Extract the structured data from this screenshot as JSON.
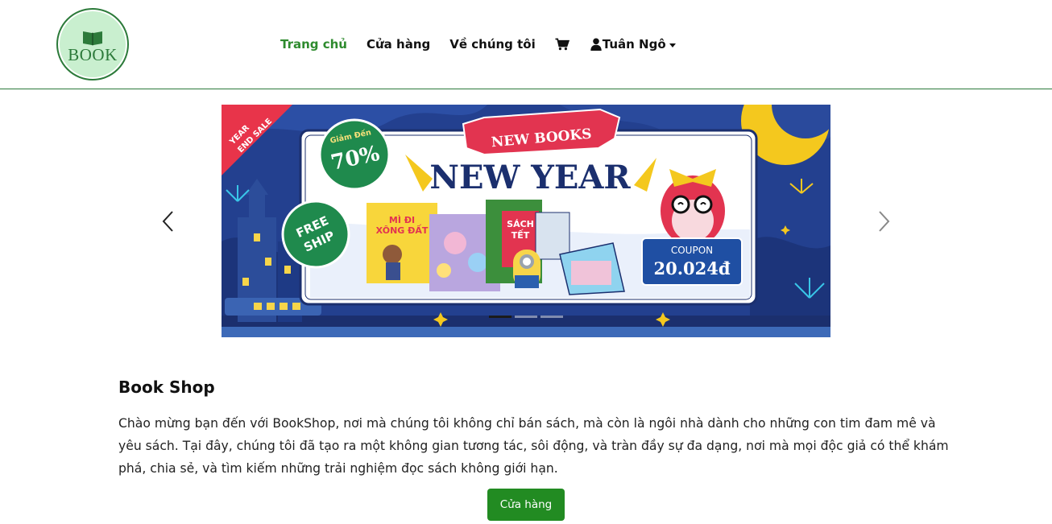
{
  "header": {
    "logo_text": "BOOK",
    "nav": [
      {
        "label": "Trang chủ",
        "active": true
      },
      {
        "label": "Cửa hàng",
        "active": false
      },
      {
        "label": "Về chúng tôi",
        "active": false
      }
    ],
    "user_name": "Tuân Ngô"
  },
  "banner": {
    "corner_ribbon": [
      "YEAR",
      "END SALE"
    ],
    "discount_prefix": "Giảm Đến",
    "discount_value": "70%",
    "free_ship": [
      "FREE",
      "SHIP"
    ],
    "ribbon_label": "NEW BOOKS",
    "headline": "NEW YEAR",
    "book_titles": [
      "MÌ ĐI",
      "XÔNG ĐẤT",
      "SÁCH",
      "TẾT"
    ],
    "coupon_label": "COUPON",
    "coupon_value": "20.024đ",
    "slides_count": 3,
    "active_slide": 0
  },
  "content": {
    "title": "Book Shop",
    "description": "Chào mừng bạn đến với BookShop, nơi mà chúng tôi không chỉ bán sách, mà còn là ngôi nhà dành cho những con tim đam mê và yêu sách. Tại đây, chúng tôi đã tạo ra một không gian tương tác, sôi động, và tràn đầy sự đa dạng, nơi mà mọi độc giả có thể khám phá, chia sẻ, và tìm kiếm những trải nghiệm đọc sách không giới hạn.",
    "button_label": "Cửa hàng"
  },
  "colors": {
    "brand_green": "#228b22",
    "active_nav": "#2e8b2e",
    "banner_blue": "#23408f",
    "coupon_blue": "#1f4fa3"
  },
  "icons": [
    "book-icon",
    "cart-icon",
    "user-icon",
    "caret-down-icon",
    "chevron-left-icon",
    "chevron-right-icon"
  ]
}
